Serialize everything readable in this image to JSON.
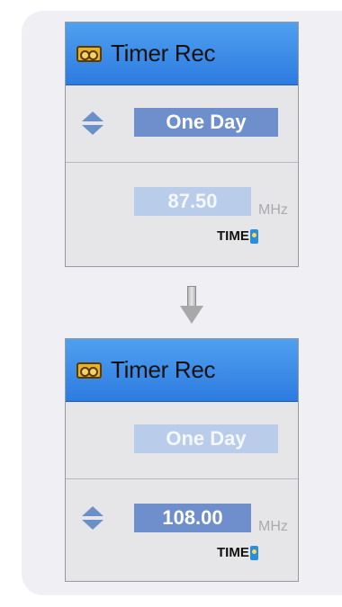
{
  "colors": {
    "title_bar": "#3a8ce8",
    "selected_box": "#6f8fcc",
    "dim_box": "#b9cdea",
    "panel_bg": "#e4e4e6"
  },
  "screens": [
    {
      "title": "Timer Rec",
      "title_icon": "tape-icon",
      "mode": {
        "value": "One Day",
        "selected": true
      },
      "frequency": {
        "value": "87.50",
        "unit": "MHz",
        "selected": false
      },
      "time_label": "TIME",
      "time_icon": "timer-clock-icon"
    },
    {
      "title": "Timer Rec",
      "title_icon": "tape-icon",
      "mode": {
        "value": "One Day",
        "selected": false
      },
      "frequency": {
        "value": "108.00",
        "unit": "MHz",
        "selected": true
      },
      "time_label": "TIME",
      "time_icon": "timer-clock-icon"
    }
  ],
  "transition_icon": "arrow-down-icon"
}
